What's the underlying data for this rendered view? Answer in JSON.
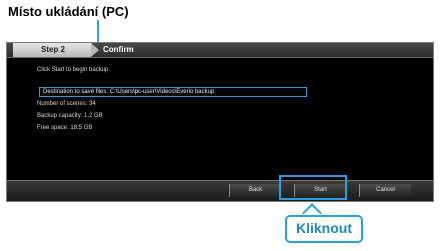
{
  "annotation": {
    "heading": "Místo ukládání (PC)",
    "callout": "Kliknout"
  },
  "dialog": {
    "tabs": {
      "step": "Step 2",
      "confirm": "Confirm"
    },
    "instruction": "Click Start to begin backup.",
    "destination": "Destination to save files: C:\\Users\\pc-user\\Videos\\Everio backup",
    "info_lines": [
      "Number of scenes: 34",
      "Backup capacity: 1.2 GB",
      "Free space: 18.5 GB"
    ],
    "buttons": {
      "back": "Back",
      "start": "Start",
      "cancel": "Cancel"
    }
  },
  "colors": {
    "accent": "#2aa0e0",
    "callout_text": "#1e88c8",
    "dialog_bg": "#000000"
  }
}
